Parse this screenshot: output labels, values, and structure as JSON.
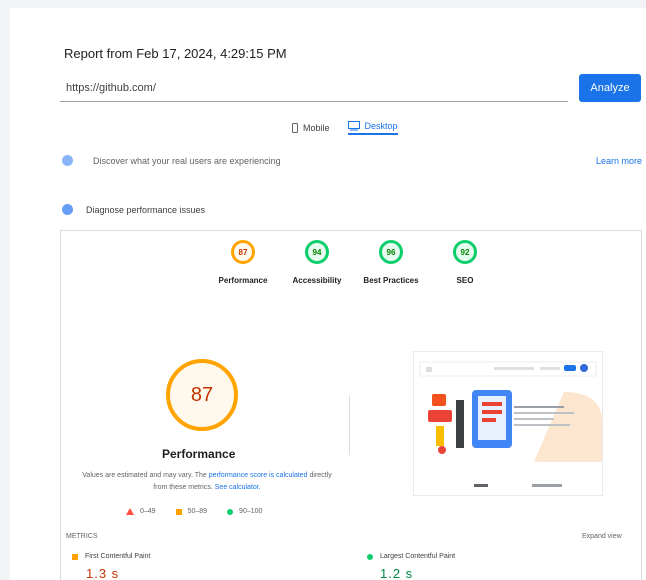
{
  "header": {
    "report_from": "Report from Feb 17, 2024, 4:29:15 PM"
  },
  "url_bar": {
    "value": "https://github.com/",
    "analyze_label": "Analyze"
  },
  "devices": [
    {
      "label": "Mobile",
      "icon": "mobile-icon",
      "active": false
    },
    {
      "label": "Desktop",
      "icon": "desktop-icon",
      "active": true
    }
  ],
  "notice": {
    "text": "Discover what your real users are experiencing",
    "link": "Learn more"
  },
  "diagnose": {
    "title": "Diagnose performance issues"
  },
  "categories": [
    {
      "label": "Performance",
      "score": "87",
      "status": "average"
    },
    {
      "label": "Accessibility",
      "score": "94",
      "status": "pass"
    },
    {
      "label": "Best Practices",
      "score": "96",
      "status": "pass"
    },
    {
      "label": "SEO",
      "score": "92",
      "status": "pass"
    }
  ],
  "performance": {
    "score": "87",
    "title": "Performance",
    "desc_prefix": "Values are estimated and may vary. The",
    "desc_link1": "performance score is calculated",
    "desc_middle": "directly from these metrics.",
    "desc_link2": "See calculator."
  },
  "legend": [
    {
      "label": "0–49"
    },
    {
      "label": "50–89"
    },
    {
      "label": "90–100"
    }
  ],
  "metrics_section": {
    "label": "METRICS",
    "expand_label": "Expand view"
  },
  "metrics": [
    {
      "name": "First Contentful Paint",
      "value": "1.3 s",
      "status": "average"
    },
    {
      "name": "Largest Contentful Paint",
      "value": "1.2 s",
      "status": "pass"
    }
  ],
  "colors": {
    "accent": "#1a73e8",
    "average": "#ffa400",
    "pass": "#0cce6b",
    "fail": "#ff4e42"
  }
}
